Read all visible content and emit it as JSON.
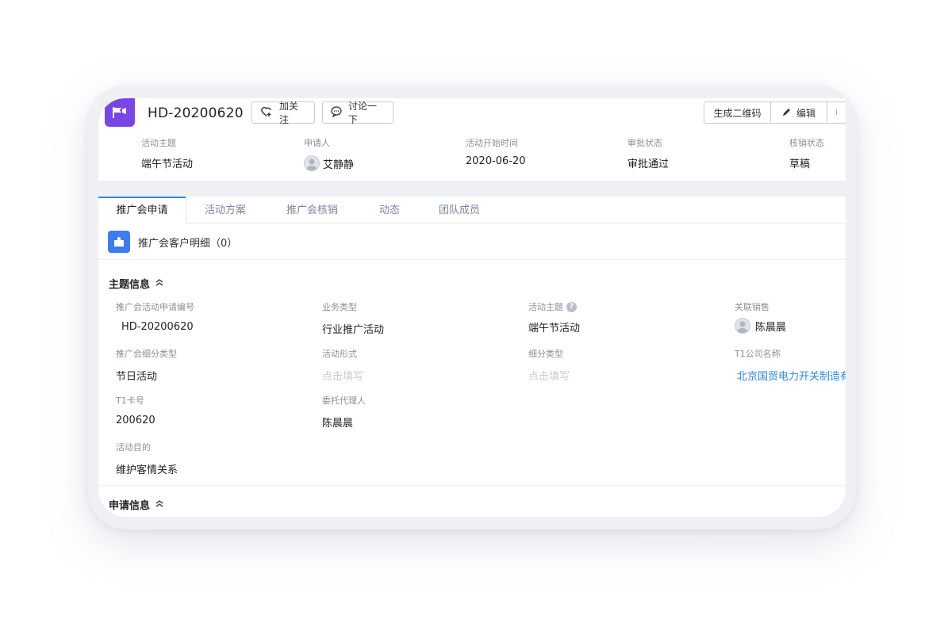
{
  "header": {
    "title": "HD-20200620",
    "follow_label": "加关注",
    "discuss_label": "讨论一下",
    "qr_label": "生成二维码",
    "edit_label": "编辑",
    "more_label": "i",
    "summary": [
      {
        "label": "活动主题",
        "value": "端午节活动"
      },
      {
        "label": "申请人",
        "value": "艾静静"
      },
      {
        "label": "活动开始时间",
        "value": "2020-06-20"
      },
      {
        "label": "审批状态",
        "value": "审批通过"
      },
      {
        "label": "核销状态",
        "value": "草稿"
      }
    ]
  },
  "tabs": [
    {
      "label": "推广会申请",
      "active": true
    },
    {
      "label": "活动方案"
    },
    {
      "label": "推广会核销"
    },
    {
      "label": "动态"
    },
    {
      "label": "团队成员"
    }
  ],
  "subhead": "推广会客户明细（0）",
  "sections": {
    "theme": "主题信息",
    "apply": "申请信息"
  },
  "fields": {
    "apply_no": {
      "label": "推广会活动申请编号",
      "value": "HD-20200620"
    },
    "biz_type": {
      "label": "业务类型",
      "value": "行业推广活动"
    },
    "theme": {
      "label": "活动主题",
      "value": "端午节活动"
    },
    "sales": {
      "label": "关联销售",
      "value": "陈晨晨"
    },
    "sub_type": {
      "label": "推广会细分类型",
      "value": "节日活动"
    },
    "form": {
      "label": "活动形式",
      "value": "点击填写"
    },
    "detail_type": {
      "label": "细分类型",
      "value": "点击填写"
    },
    "company": {
      "label": "T1公司名称",
      "value": "北京国贸电力开关制造有"
    },
    "card_no": {
      "label": "T1卡号",
      "value": "200620"
    },
    "agent": {
      "label": "委托代理人",
      "value": "陈晨晨"
    },
    "purpose": {
      "label": "活动目的",
      "value": "维护客情关系"
    }
  },
  "colors": {
    "accent": "#2a8ae6",
    "app_icon": "#7a45e5",
    "puzzle": "#3d7cf3"
  }
}
